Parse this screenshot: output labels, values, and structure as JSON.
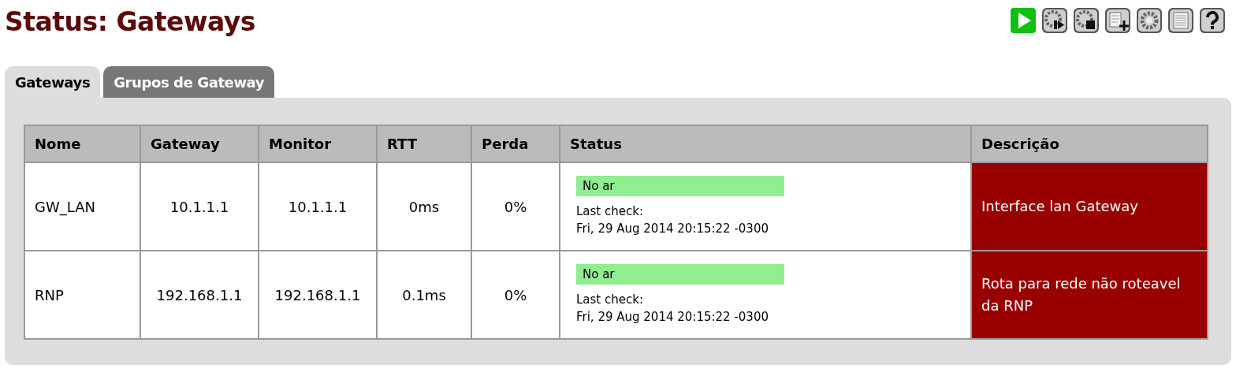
{
  "page_title": "Status: Gateways",
  "tabs": [
    {
      "label": "Gateways",
      "selected": true
    },
    {
      "label": "Grupos de Gateway",
      "selected": false
    }
  ],
  "table": {
    "columns": [
      "Nome",
      "Gateway",
      "Monitor",
      "RTT",
      "Perda",
      "Status",
      "Descrição"
    ],
    "rows": [
      {
        "name": "GW_LAN",
        "gateway": "10.1.1.1",
        "monitor": "10.1.1.1",
        "rtt": "0ms",
        "loss": "0%",
        "status": {
          "label": "No ar",
          "color": "#90ee90",
          "check_label": "Last check:",
          "check_time": "Fri, 29 Aug 2014 20:15:22 -0300"
        },
        "description": "Interface lan Gateway"
      },
      {
        "name": "RNP",
        "gateway": "192.168.1.1",
        "monitor": "192.168.1.1",
        "rtt": "0.1ms",
        "loss": "0%",
        "status": {
          "label": "No ar",
          "color": "#90ee90",
          "check_label": "Last check:",
          "check_time": "Fri, 29 Aug 2014 20:15:22 -0300"
        },
        "description": "Rota para rede não roteavel da RNP"
      }
    ]
  }
}
